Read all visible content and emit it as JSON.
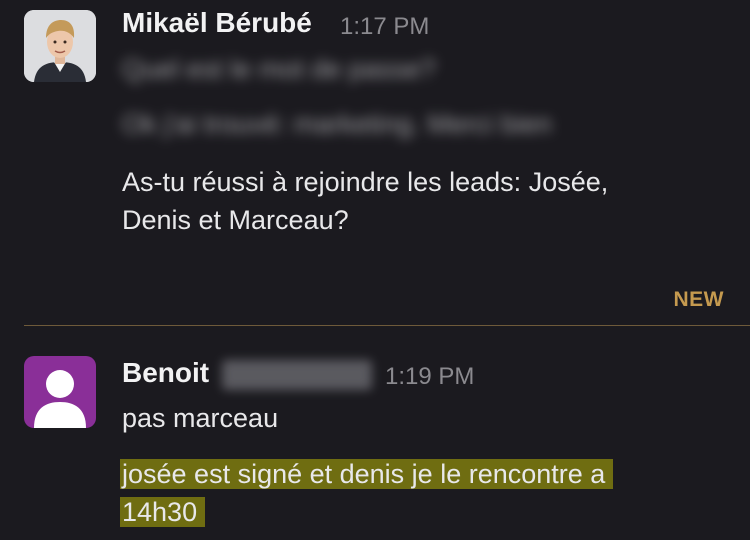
{
  "messages": [
    {
      "author": "Mikaël Bérubé",
      "time": "1:17 PM",
      "lines": [
        "Quel est le mot de passe?",
        "Ok j'ai trouvé: marketing. Merci bien",
        "As-tu réussi à rejoindre les leads: Josée,",
        "Denis et Marceau?"
      ]
    },
    {
      "author": "Benoit",
      "time": "1:19 PM",
      "lines": [
        "pas marceau",
        "josée est signé et denis je le rencontre a",
        "14h30"
      ]
    }
  ],
  "divider_label": "NEW",
  "colors": {
    "background": "#1b1a1f",
    "new_divider": "#c59a4f",
    "highlight": "#6f6d11",
    "avatar_generic": "#8a2f98"
  }
}
